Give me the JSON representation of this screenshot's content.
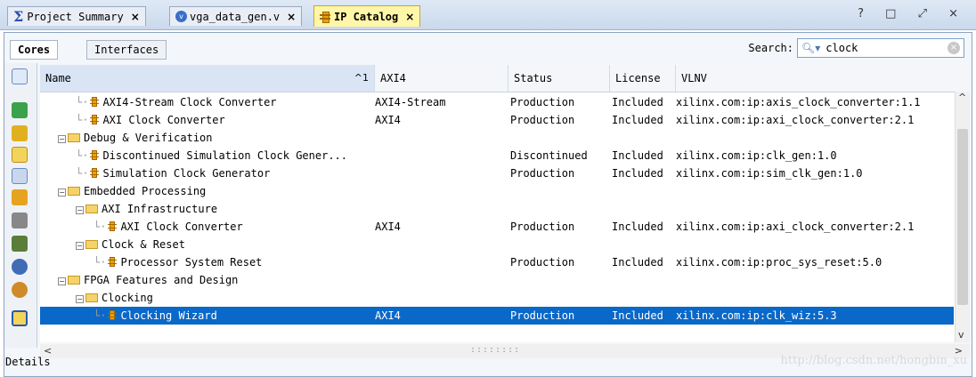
{
  "tabs": [
    {
      "label": "Project Summary",
      "icon": "sigma-icon",
      "active": false
    },
    {
      "label": "vga_data_gen.v",
      "icon": "verilog-file-icon",
      "active": false
    },
    {
      "label": "IP Catalog",
      "icon": "ip-core-icon",
      "active": true
    }
  ],
  "window_controls": "? □ ⤢ ×",
  "subtabs": {
    "cores": "Cores",
    "interfaces": "Interfaces"
  },
  "search": {
    "label": "Search:",
    "value": "clock"
  },
  "columns": {
    "name": "Name",
    "sort_indicator": "^1",
    "axi4": "AXI4",
    "status": "Status",
    "license": "License",
    "vlnv": "VLNV"
  },
  "rows": [
    {
      "type": "ip",
      "indent": "   ",
      "name": "AXI4-Stream Clock Converter",
      "axi4": "AXI4-Stream",
      "status": "Production",
      "license": "Included",
      "vlnv": "xilinx.com:ip:axis_clock_converter:1.1"
    },
    {
      "type": "ip",
      "indent": "   ",
      "name": "AXI Clock Converter",
      "axi4": "AXI4",
      "status": "Production",
      "license": "Included",
      "vlnv": "xilinx.com:ip:axi_clock_converter:2.1"
    },
    {
      "type": "folder",
      "indent": " ",
      "name": "Debug & Verification",
      "axi4": "",
      "status": "",
      "license": "",
      "vlnv": ""
    },
    {
      "type": "ip",
      "indent": "   ",
      "name": "Discontinued Simulation Clock Gener...",
      "axi4": "",
      "status": "Discontinued",
      "license": "Included",
      "vlnv": "xilinx.com:ip:clk_gen:1.0"
    },
    {
      "type": "ip",
      "indent": "   ",
      "name": "Simulation Clock Generator",
      "axi4": "",
      "status": "Production",
      "license": "Included",
      "vlnv": "xilinx.com:ip:sim_clk_gen:1.0"
    },
    {
      "type": "folder",
      "indent": " ",
      "name": "Embedded Processing",
      "axi4": "",
      "status": "",
      "license": "",
      "vlnv": ""
    },
    {
      "type": "folder",
      "indent": "   ",
      "name": "AXI Infrastructure",
      "axi4": "",
      "status": "",
      "license": "",
      "vlnv": ""
    },
    {
      "type": "ip",
      "indent": "     ",
      "name": "AXI Clock Converter",
      "axi4": "AXI4",
      "status": "Production",
      "license": "Included",
      "vlnv": "xilinx.com:ip:axi_clock_converter:2.1"
    },
    {
      "type": "folder",
      "indent": "   ",
      "name": "Clock & Reset",
      "axi4": "",
      "status": "",
      "license": "",
      "vlnv": ""
    },
    {
      "type": "ip",
      "indent": "     ",
      "name": "Processor System Reset",
      "axi4": "",
      "status": "Production",
      "license": "Included",
      "vlnv": "xilinx.com:ip:proc_sys_reset:5.0"
    },
    {
      "type": "folder",
      "indent": " ",
      "name": "FPGA Features and Design",
      "axi4": "",
      "status": "",
      "license": "",
      "vlnv": ""
    },
    {
      "type": "folder",
      "indent": "   ",
      "name": "Clocking",
      "axi4": "",
      "status": "",
      "license": "",
      "vlnv": ""
    },
    {
      "type": "ip",
      "indent": "     ",
      "name": "Clocking Wizard",
      "axi4": "AXI4",
      "status": "Production",
      "license": "Included",
      "vlnv": "xilinx.com:ip:clk_wiz:5.3",
      "selected": true
    }
  ],
  "details_label": "Details",
  "watermark": "http://blog.csdn.net/hongbin_xu",
  "colors": {
    "selection": "#0a68c8",
    "active_tab": "#fff6a8",
    "folder": "#f5d36a",
    "ip_icon": "#e8a20c"
  }
}
